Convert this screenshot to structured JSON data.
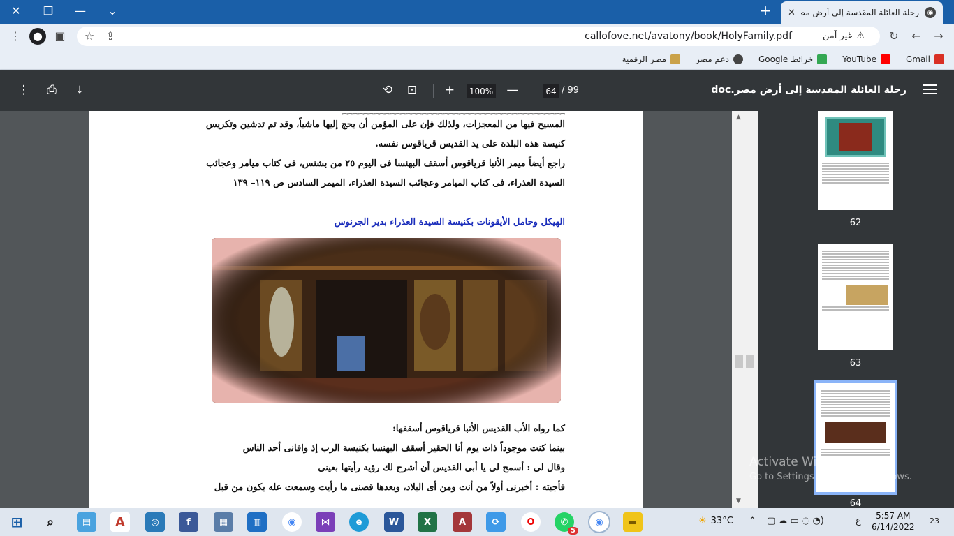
{
  "browser": {
    "tab_title": "رحلة العائلة المقدسة إلى أرض مصر",
    "tab_close": "✕",
    "new_tab": "+",
    "url": "callofove.net/avatony/book/HolyFamily.pdf",
    "security_label": "غير آمن",
    "window_controls": {
      "minimize": "—",
      "restore": "❐",
      "close": "✕",
      "tab_search": "⌄"
    }
  },
  "bookmarks": [
    {
      "label": "Gmail",
      "icon": "gmail-icon",
      "color": "#d93025"
    },
    {
      "label": "YouTube",
      "icon": "youtube-icon",
      "color": "#ff0000"
    },
    {
      "label": "خرائط Google",
      "icon": "maps-icon",
      "color": "#34a853"
    },
    {
      "label": "دعم مصر",
      "icon": "globe-icon",
      "color": "#444444"
    },
    {
      "label": "مصر الرقمية",
      "icon": "digital-egypt-icon",
      "color": "#caa24a"
    }
  ],
  "pdf_toolbar": {
    "doc_title": "رحلة العائلة المقدسة إلى أرض مصر.doc",
    "page_current": "64",
    "page_total": "/ 99",
    "zoom": "100%",
    "zoom_in": "+",
    "zoom_out": "—"
  },
  "document": {
    "lines_top": [
      "المسيح فيها من المعجزات، ولذلك فإن على المؤمن أن يحج إليها ماشياً، وقد تم تدشين وتكريس",
      "كنيسة هذه البلدة على يد القديس قرياقوس نفسه.",
      "راجع أيضاً ميمر الأنبا قرياقوس أسقف البهنسا فى اليوم ٢٥ من بشنس، فى كتاب ميامر وعجائب",
      "السيدة العذراء، فى كتاب الميامر وعجائب السيدة العذراء، الميمر السادس ص ١١٩– ١٣٩"
    ],
    "heading": "الهيكل وحامل الأيقونات بكنيسة السيدة العذراء بدير الجرنوس",
    "lines_bottom": [
      "كما رواه الأب القديس الأنبا قرياقوس أسقفها:",
      "بينما كنت موجوداً ذات يوم أنا الحقير أسقف البهنسا بكنيسة الرب إذ وافانى أحد الناس",
      "وقال لى : أسمح لى يا أبى القديس أن أشرح لك رؤية رأيتها بعينى",
      "فأجبته : أخبرنى أولاً من أنت ومن أى البلاد، وبعدها قصنى ما رأيت وسمعت عله يكون من قبل"
    ]
  },
  "thumbnails": [
    {
      "page": "62",
      "selected": false
    },
    {
      "page": "63",
      "selected": false
    },
    {
      "page": "64",
      "selected": true
    }
  ],
  "watermark": {
    "line1": "Activate Windows",
    "line2": "Go to Settings to activate Windows."
  },
  "taskbar": {
    "temperature": "33°C",
    "time": "5:57 AM",
    "date": "6/14/2022",
    "notifications": "23",
    "whatsapp_badge": "5",
    "lang": "ع"
  }
}
